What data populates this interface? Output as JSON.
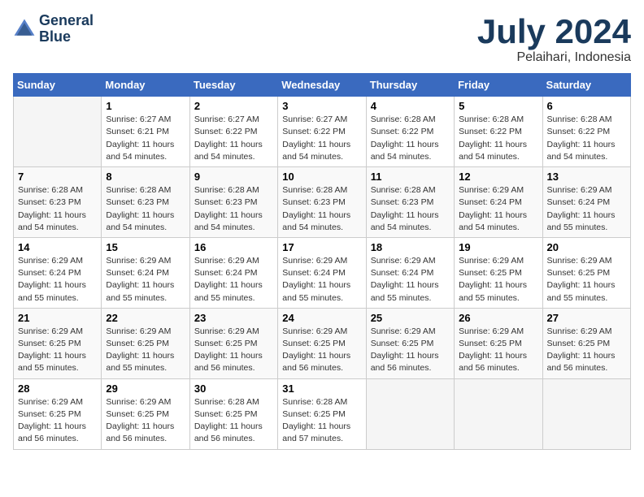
{
  "header": {
    "logo_line1": "General",
    "logo_line2": "Blue",
    "month_title": "July 2024",
    "subtitle": "Pelaihari, Indonesia"
  },
  "days_of_week": [
    "Sunday",
    "Monday",
    "Tuesday",
    "Wednesday",
    "Thursday",
    "Friday",
    "Saturday"
  ],
  "weeks": [
    [
      {
        "day": "",
        "info": ""
      },
      {
        "day": "1",
        "info": "Sunrise: 6:27 AM\nSunset: 6:21 PM\nDaylight: 11 hours\nand 54 minutes."
      },
      {
        "day": "2",
        "info": "Sunrise: 6:27 AM\nSunset: 6:22 PM\nDaylight: 11 hours\nand 54 minutes."
      },
      {
        "day": "3",
        "info": "Sunrise: 6:27 AM\nSunset: 6:22 PM\nDaylight: 11 hours\nand 54 minutes."
      },
      {
        "day": "4",
        "info": "Sunrise: 6:28 AM\nSunset: 6:22 PM\nDaylight: 11 hours\nand 54 minutes."
      },
      {
        "day": "5",
        "info": "Sunrise: 6:28 AM\nSunset: 6:22 PM\nDaylight: 11 hours\nand 54 minutes."
      },
      {
        "day": "6",
        "info": "Sunrise: 6:28 AM\nSunset: 6:22 PM\nDaylight: 11 hours\nand 54 minutes."
      }
    ],
    [
      {
        "day": "7",
        "info": "Sunrise: 6:28 AM\nSunset: 6:23 PM\nDaylight: 11 hours\nand 54 minutes."
      },
      {
        "day": "8",
        "info": "Sunrise: 6:28 AM\nSunset: 6:23 PM\nDaylight: 11 hours\nand 54 minutes."
      },
      {
        "day": "9",
        "info": "Sunrise: 6:28 AM\nSunset: 6:23 PM\nDaylight: 11 hours\nand 54 minutes."
      },
      {
        "day": "10",
        "info": "Sunrise: 6:28 AM\nSunset: 6:23 PM\nDaylight: 11 hours\nand 54 minutes."
      },
      {
        "day": "11",
        "info": "Sunrise: 6:28 AM\nSunset: 6:23 PM\nDaylight: 11 hours\nand 54 minutes."
      },
      {
        "day": "12",
        "info": "Sunrise: 6:29 AM\nSunset: 6:24 PM\nDaylight: 11 hours\nand 54 minutes."
      },
      {
        "day": "13",
        "info": "Sunrise: 6:29 AM\nSunset: 6:24 PM\nDaylight: 11 hours\nand 55 minutes."
      }
    ],
    [
      {
        "day": "14",
        "info": "Sunrise: 6:29 AM\nSunset: 6:24 PM\nDaylight: 11 hours\nand 55 minutes."
      },
      {
        "day": "15",
        "info": "Sunrise: 6:29 AM\nSunset: 6:24 PM\nDaylight: 11 hours\nand 55 minutes."
      },
      {
        "day": "16",
        "info": "Sunrise: 6:29 AM\nSunset: 6:24 PM\nDaylight: 11 hours\nand 55 minutes."
      },
      {
        "day": "17",
        "info": "Sunrise: 6:29 AM\nSunset: 6:24 PM\nDaylight: 11 hours\nand 55 minutes."
      },
      {
        "day": "18",
        "info": "Sunrise: 6:29 AM\nSunset: 6:24 PM\nDaylight: 11 hours\nand 55 minutes."
      },
      {
        "day": "19",
        "info": "Sunrise: 6:29 AM\nSunset: 6:25 PM\nDaylight: 11 hours\nand 55 minutes."
      },
      {
        "day": "20",
        "info": "Sunrise: 6:29 AM\nSunset: 6:25 PM\nDaylight: 11 hours\nand 55 minutes."
      }
    ],
    [
      {
        "day": "21",
        "info": "Sunrise: 6:29 AM\nSunset: 6:25 PM\nDaylight: 11 hours\nand 55 minutes."
      },
      {
        "day": "22",
        "info": "Sunrise: 6:29 AM\nSunset: 6:25 PM\nDaylight: 11 hours\nand 55 minutes."
      },
      {
        "day": "23",
        "info": "Sunrise: 6:29 AM\nSunset: 6:25 PM\nDaylight: 11 hours\nand 56 minutes."
      },
      {
        "day": "24",
        "info": "Sunrise: 6:29 AM\nSunset: 6:25 PM\nDaylight: 11 hours\nand 56 minutes."
      },
      {
        "day": "25",
        "info": "Sunrise: 6:29 AM\nSunset: 6:25 PM\nDaylight: 11 hours\nand 56 minutes."
      },
      {
        "day": "26",
        "info": "Sunrise: 6:29 AM\nSunset: 6:25 PM\nDaylight: 11 hours\nand 56 minutes."
      },
      {
        "day": "27",
        "info": "Sunrise: 6:29 AM\nSunset: 6:25 PM\nDaylight: 11 hours\nand 56 minutes."
      }
    ],
    [
      {
        "day": "28",
        "info": "Sunrise: 6:29 AM\nSunset: 6:25 PM\nDaylight: 11 hours\nand 56 minutes."
      },
      {
        "day": "29",
        "info": "Sunrise: 6:29 AM\nSunset: 6:25 PM\nDaylight: 11 hours\nand 56 minutes."
      },
      {
        "day": "30",
        "info": "Sunrise: 6:28 AM\nSunset: 6:25 PM\nDaylight: 11 hours\nand 56 minutes."
      },
      {
        "day": "31",
        "info": "Sunrise: 6:28 AM\nSunset: 6:25 PM\nDaylight: 11 hours\nand 57 minutes."
      },
      {
        "day": "",
        "info": ""
      },
      {
        "day": "",
        "info": ""
      },
      {
        "day": "",
        "info": ""
      }
    ]
  ]
}
